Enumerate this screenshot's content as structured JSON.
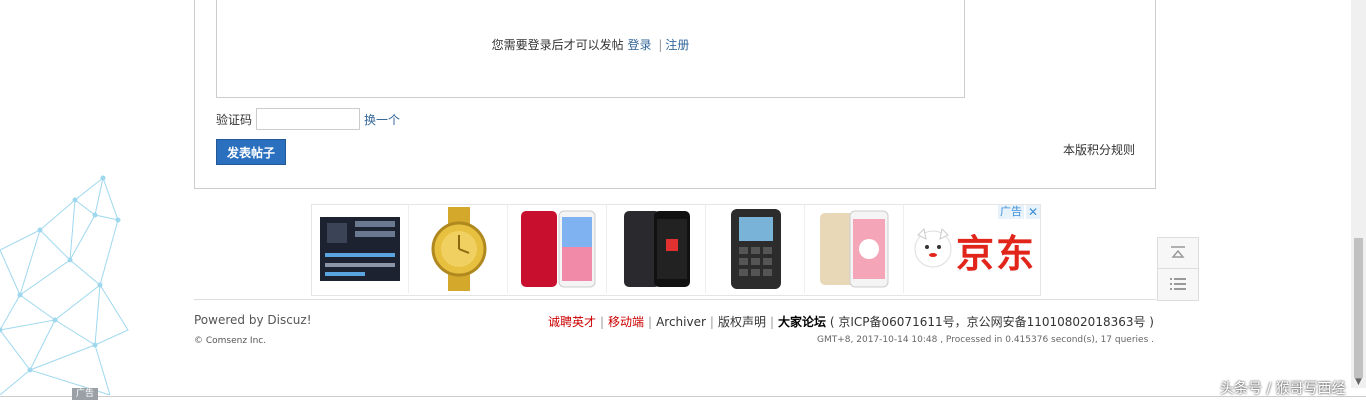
{
  "post_panel": {
    "login_prompt": "您需要登录后才可以发帖",
    "login_link": "登录",
    "separator": "|",
    "register_link": "注册",
    "captcha_label": "验证码",
    "captcha_value": "",
    "captcha_refresh": "换一个",
    "submit_label": "发表帖子",
    "rules_link": "本版积分规则"
  },
  "ad_strip": {
    "items": [
      "motherboard",
      "gold-watch",
      "red-iphone",
      "black-smartphone",
      "rugged-feature-phone",
      "gold-smartphone"
    ],
    "brand_text": "京东",
    "ad_label": "广告",
    "close_label": "✕"
  },
  "float_bar": {
    "top_icon": "back-to-top-icon",
    "list_icon": "list-icon"
  },
  "footer": {
    "powered": "Powered by Discuz!",
    "copyright": "© Comsenz Inc.",
    "links": [
      {
        "label": "诚聘英才",
        "color": "#cc0000"
      },
      {
        "label": "移动端",
        "color": "#cc0000"
      },
      {
        "label": "Archiver",
        "color": "#333333"
      },
      {
        "label": "版权声明",
        "color": "#333333"
      }
    ],
    "site_name": "大家论坛",
    "icp": "( 京ICP备06071611号，京公网安备11010802018363号 )",
    "runtime": "GMT+8, 2017-10-14 10:48 , Processed in 0.415376 second(s), 17 queries ."
  },
  "bottom": {
    "ad_badge": "广告",
    "watermark": "头条号 / 猴哥写西经"
  }
}
